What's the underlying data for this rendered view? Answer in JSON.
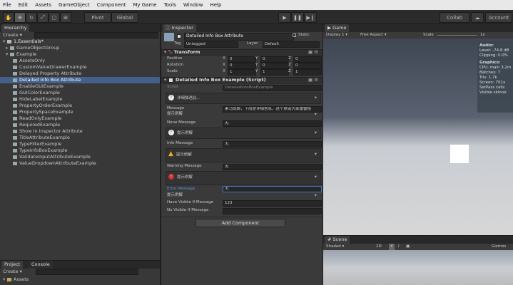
{
  "menu": [
    "File",
    "Edit",
    "Assets",
    "GameObject",
    "Component",
    "My Game",
    "Tools",
    "Window",
    "Help"
  ],
  "toolbar": {
    "pivot": "Pivot",
    "global": "Global",
    "collab": "Collab",
    "account": "Account"
  },
  "hierarchy": {
    "tab": "Hierarchy",
    "create": "Create",
    "scene": "1.Essentials*",
    "items": [
      "GameObjectGroup",
      "Example",
      "AssetsOnly",
      "CustomValueDrawerExample",
      "Delayed Property Attribute",
      "Detailed Info Box Attribute",
      "EnableGUIExample",
      "GUIColorExample",
      "HideLabelExample",
      "PropertyOrderExample",
      "PropertySpaceExample",
      "ReadOnlyExample",
      "RequiredExample",
      "Show In Inspector Attribute",
      "TitleAttributeExample",
      "TypeFilterExample",
      "TypeInfoBoxExample",
      "ValidateInputAttributeExample",
      "ValueDropdownAttributeExample"
    ]
  },
  "project": {
    "tab1": "Project",
    "tab2": "Console",
    "create": "Create",
    "assets": "Assets"
  },
  "inspector": {
    "tab": "Inspector",
    "object_name": "Detailed Info Box Attribute",
    "static": "Static",
    "tag_label": "Tag",
    "tag_value": "Untagged",
    "layer_label": "Layer",
    "layer_value": "Default",
    "transform": {
      "title": "Transform",
      "position": "Position",
      "rotation": "Rotation",
      "scale": "Scale",
      "pos": [
        "0",
        "0",
        "0"
      ],
      "rot": [
        "0",
        "0",
        "0"
      ],
      "scl": [
        "1",
        "1",
        "1"
      ],
      "axes": [
        "X",
        "Y",
        "Z"
      ]
    },
    "script_comp": {
      "title": "Detailed Info Box Example (Script)",
      "script_label": "Script",
      "script_value": "DetailedInfoBoxExample"
    },
    "info1": "详细描述此...",
    "message_label": "Message",
    "message_value": "果马既邮，下雨是详细信息，这个肤诞大家雷雷报",
    "hint1": "提示例解",
    "none_label": "None Message",
    "none_value": "无",
    "info2": "提示例解",
    "info_label": "Info Message",
    "info_value": "无",
    "info3": "提示例解",
    "warning_label": "Warning Message",
    "warning_value": "无",
    "info4": "提示例解",
    "error_label": "Error Message",
    "error_value": "无",
    "hint2": "提示例解",
    "visible_label": "Have Visible If Message",
    "visible_value": "123",
    "novisible_label": "No Visible If Message",
    "novisible_value": "",
    "add_component": "Add Component"
  },
  "game": {
    "tab": "Game",
    "display": "Display 1",
    "aspect": "Free Aspect",
    "scale_label": "Scale",
    "scale_value": "1x",
    "maximize": "Maximize on Play",
    "stats": {
      "audio": "Audio:",
      "level": "Level: -74.8 dB",
      "clipping": "Clipping: 0.0%",
      "graphics": "Graphics:",
      "cpu": "CPU: main 3.2ms",
      "batches": "Batches: 7",
      "tris": "Tris: 1.7k",
      "screen": "Screen: 701x",
      "setpass": "SetPass calls",
      "skinned": "Visible skinne"
    }
  },
  "scene": {
    "tab": "Scene",
    "shaded": "Shaded",
    "mode": "2D",
    "gizmos": "Gizmos"
  }
}
